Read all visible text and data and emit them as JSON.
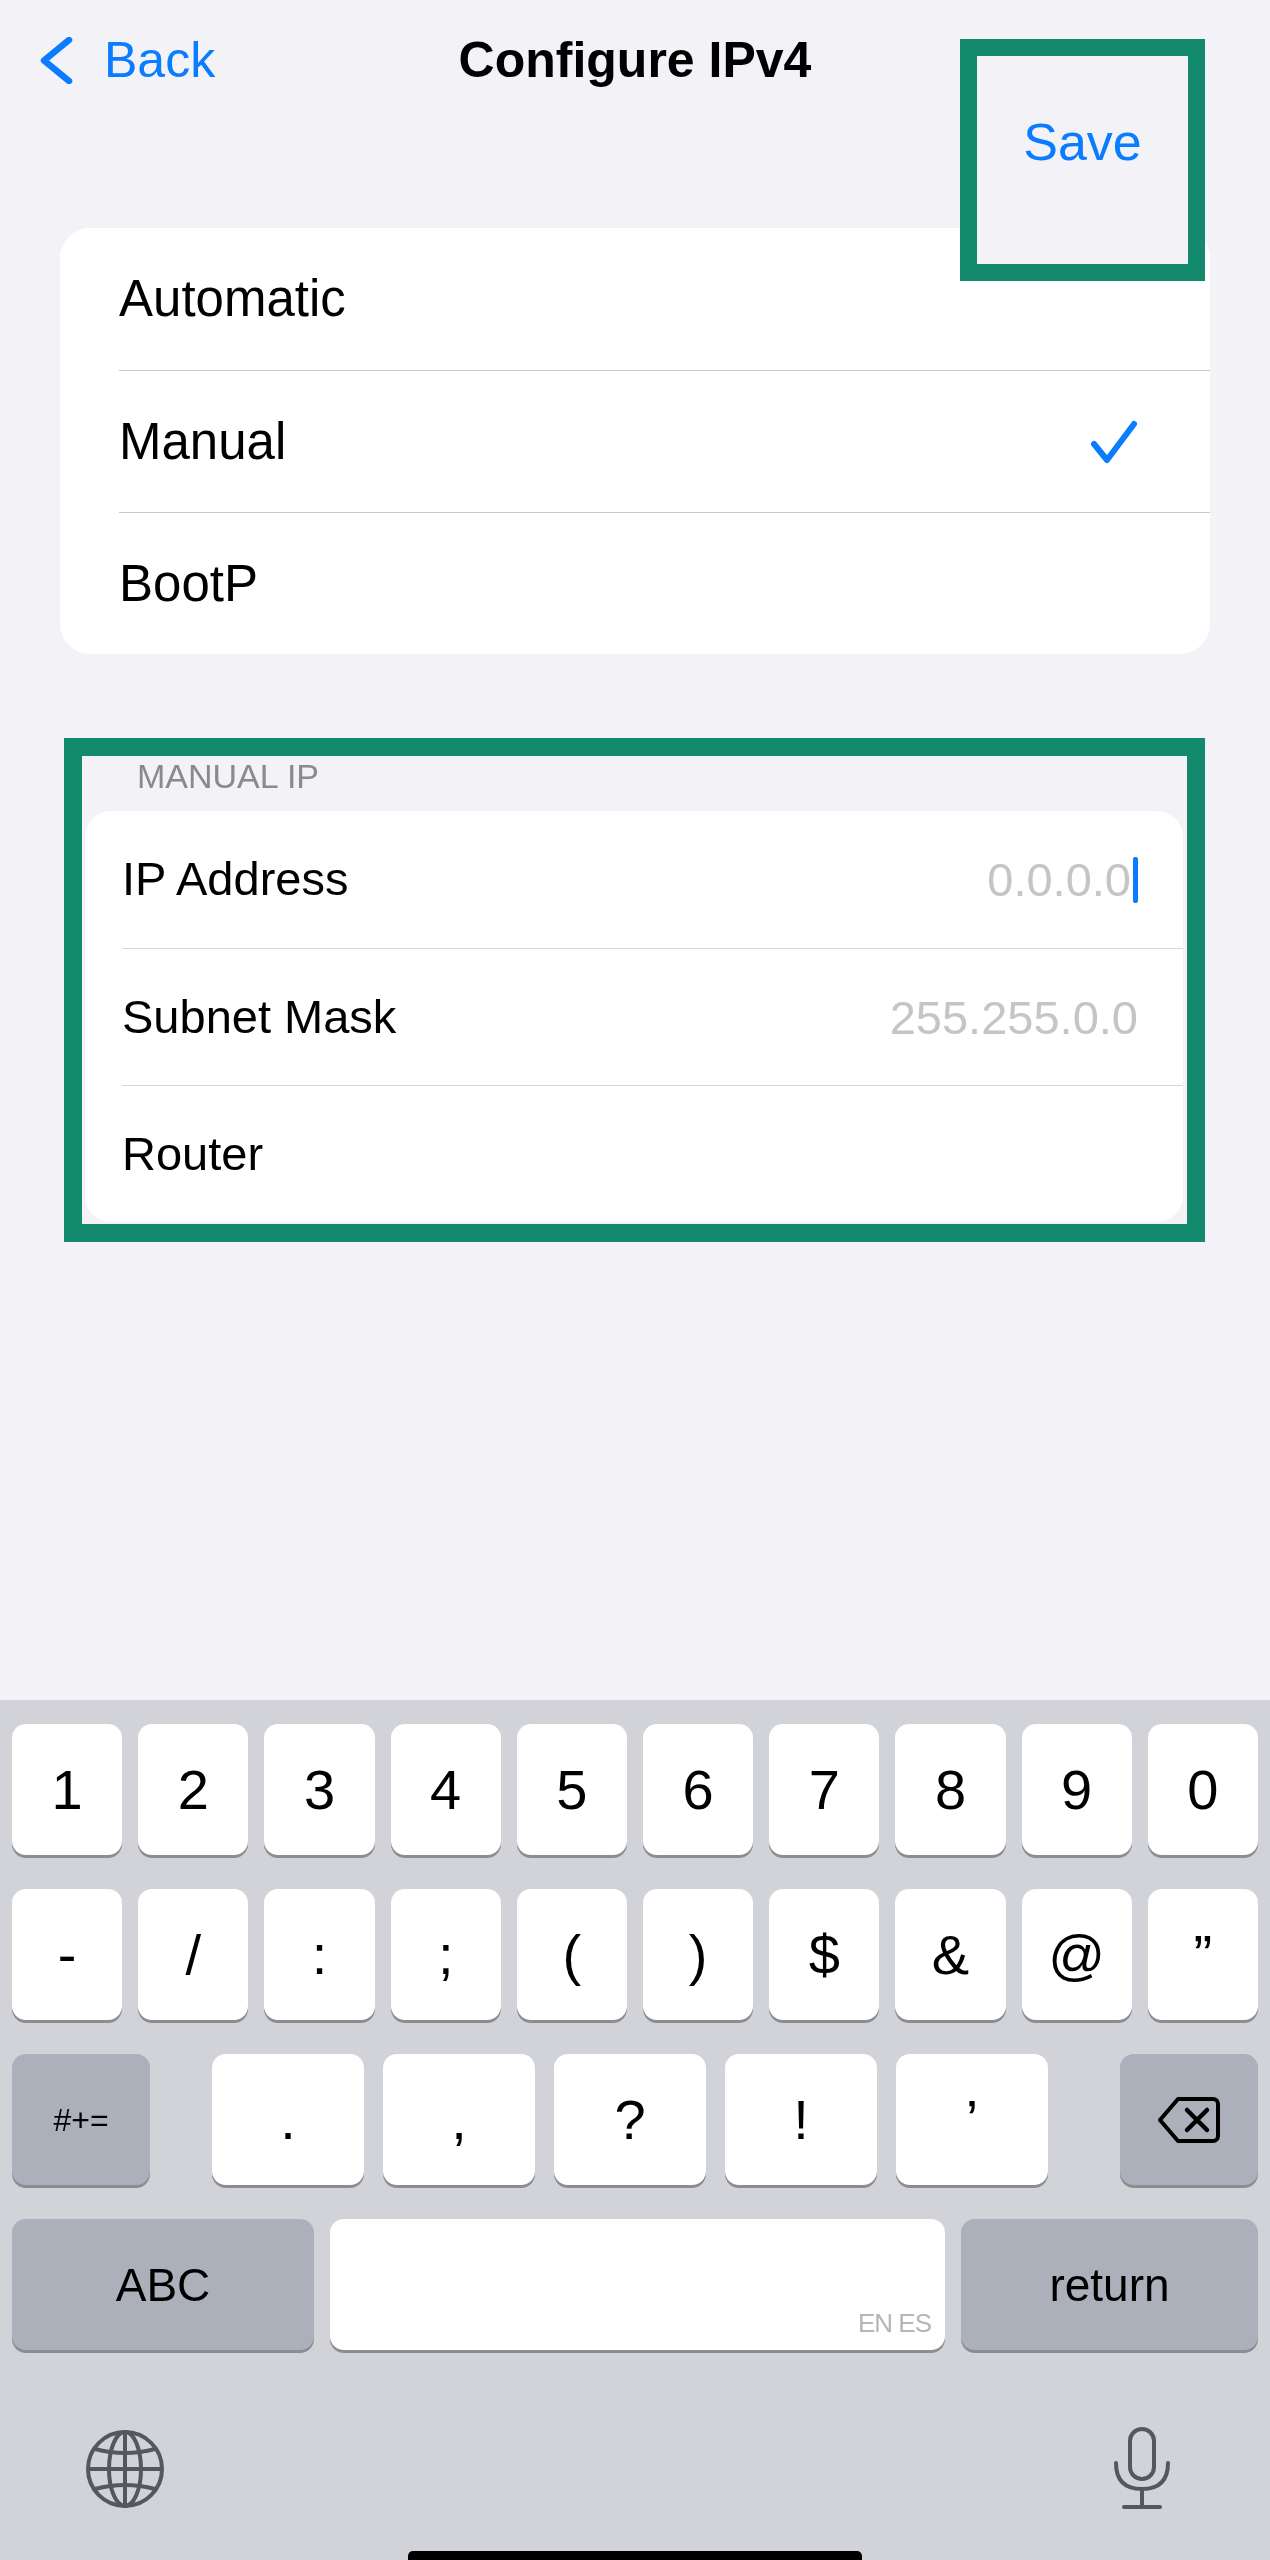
{
  "nav": {
    "back": "Back",
    "title": "Configure IPv4",
    "save": {
      "label": "Save",
      "highlighted": true
    }
  },
  "modes": [
    {
      "label": "Automatic",
      "selected": false
    },
    {
      "label": "Manual",
      "selected": true
    },
    {
      "label": "BootP",
      "selected": false
    }
  ],
  "manual_ip": {
    "header": "MANUAL IP",
    "highlighted": true,
    "fields": [
      {
        "label": "IP Address",
        "placeholder": "0.0.0.0",
        "focused": true
      },
      {
        "label": "Subnet Mask",
        "placeholder": "255.255.0.0",
        "focused": false
      },
      {
        "label": "Router",
        "focused": false
      }
    ]
  },
  "keyboard": {
    "number_keys": [
      {
        "kind": "char",
        "label": "1"
      },
      {
        "kind": "char",
        "label": "2"
      },
      {
        "kind": "char",
        "label": "3"
      },
      {
        "kind": "char",
        "label": "4"
      },
      {
        "kind": "char",
        "label": "5"
      },
      {
        "kind": "char",
        "label": "6"
      },
      {
        "kind": "char",
        "label": "7"
      },
      {
        "kind": "char",
        "label": "8"
      },
      {
        "kind": "char",
        "label": "9"
      },
      {
        "kind": "char",
        "label": "0"
      }
    ],
    "symbol_keys": [
      {
        "kind": "char",
        "label": "-"
      },
      {
        "kind": "char",
        "label": "/"
      },
      {
        "kind": "char",
        "label": ":"
      },
      {
        "kind": "char",
        "label": ";"
      },
      {
        "kind": "char",
        "label": "("
      },
      {
        "kind": "char",
        "label": ")"
      },
      {
        "kind": "char",
        "label": "$"
      },
      {
        "kind": "char",
        "label": "&"
      },
      {
        "kind": "char",
        "label": "@"
      },
      {
        "kind": "char",
        "label": "”"
      }
    ],
    "punctuation_keys": [
      {
        "kind": "symbols",
        "label": "#+="
      },
      {
        "kind": "char",
        "label": "."
      },
      {
        "kind": "char",
        "label": ","
      },
      {
        "kind": "char",
        "label": "?"
      },
      {
        "kind": "char",
        "label": "!"
      },
      {
        "kind": "char",
        "label": "’"
      },
      {
        "kind": "delete"
      }
    ],
    "bottom_keys": [
      {
        "kind": "mode",
        "label": "ABC"
      },
      {
        "kind": "space",
        "label": "EN ES"
      },
      {
        "kind": "return",
        "label": "return"
      }
    ]
  }
}
